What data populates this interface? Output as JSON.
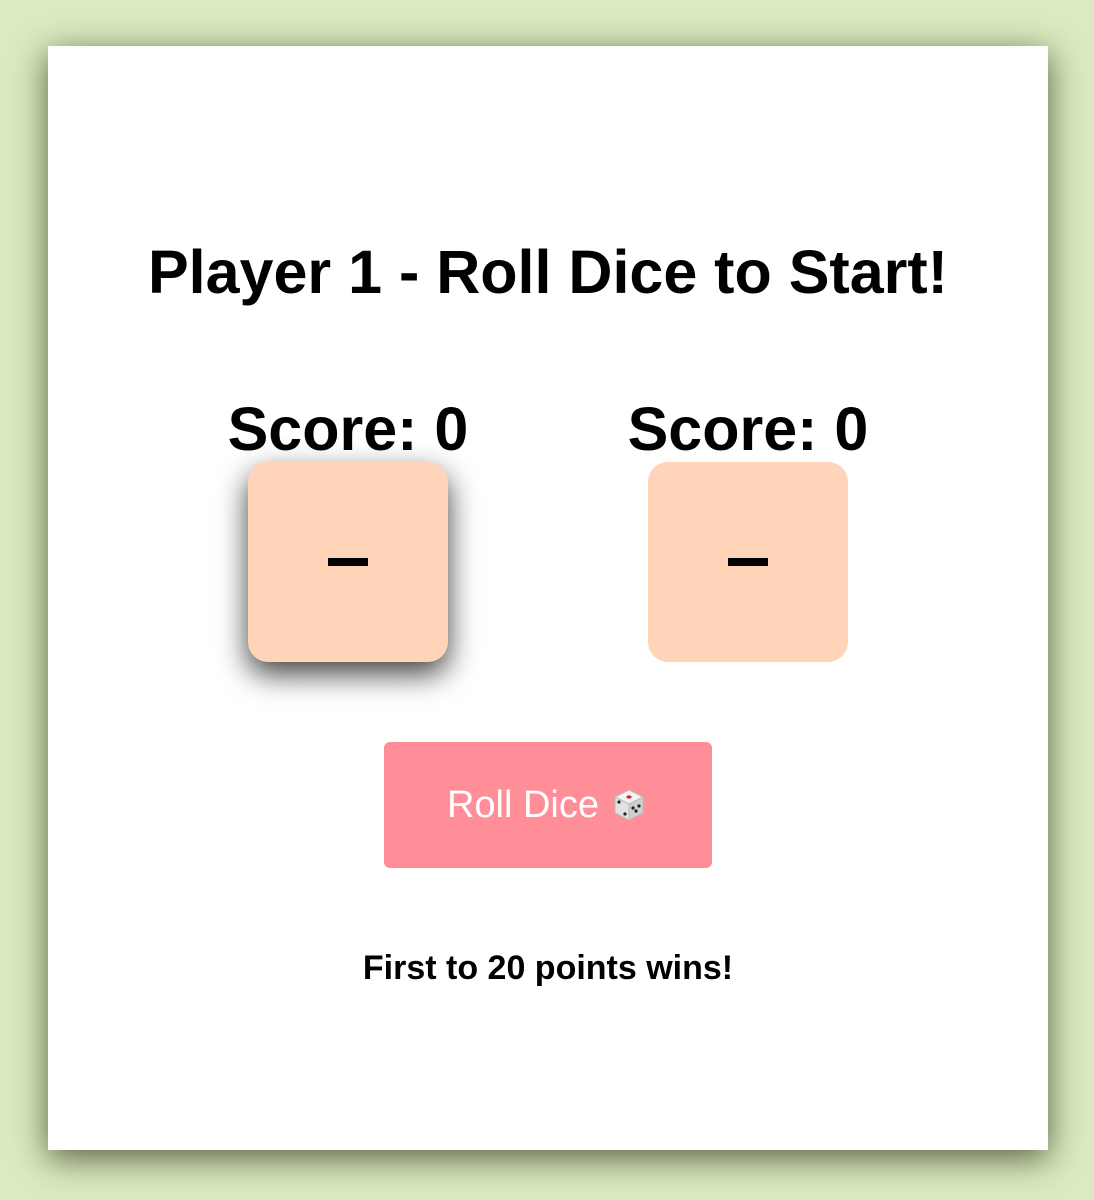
{
  "game": {
    "status_title": "Player 1 - Roll Dice to Start!",
    "roll_button_label": "Roll Dice",
    "rule_text": "First to 20 points wins!",
    "active_player": 1
  },
  "players": [
    {
      "score_label": "Score: 0",
      "score": 0,
      "die_value": "-"
    },
    {
      "score_label": "Score: 0",
      "score": 0,
      "die_value": "-"
    }
  ],
  "icons": {
    "roll_button_icon": "dice-icon"
  },
  "colors": {
    "page_background": "#dbeac0",
    "card_background": "#ffffff",
    "die_background": "#ffd4b9",
    "button_background": "#ff8e99",
    "button_text": "#ffffff"
  }
}
